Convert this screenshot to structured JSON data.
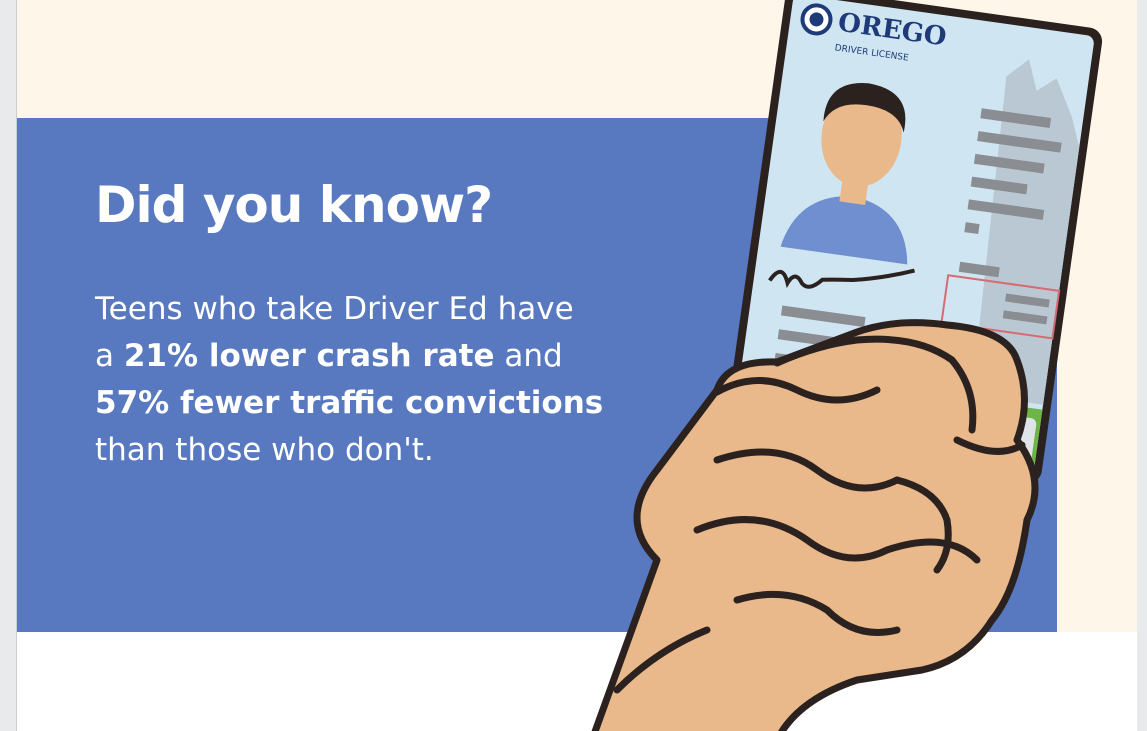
{
  "headline": "Did you know?",
  "body": {
    "line1": "Teens who take Driver Ed have",
    "line2_prefix": "a ",
    "line2_bold": "21% lower crash rate",
    "line2_suffix": " and",
    "line3_bold": "57% fewer traffic convictions",
    "line4": "than those who don't."
  },
  "license_card": {
    "state": "OREGO",
    "card_type": "DRIVER LICENSE"
  },
  "colors": {
    "panel_blue": "#5878bf",
    "background_cream": "#fdf6e9",
    "card_light_blue": "#cfe6f2",
    "card_green": "#6db546",
    "skin": "#e9b98c",
    "outline": "#2b2220"
  },
  "icons": [
    "oregon-seal-icon",
    "fist-holding-license-illustration"
  ]
}
